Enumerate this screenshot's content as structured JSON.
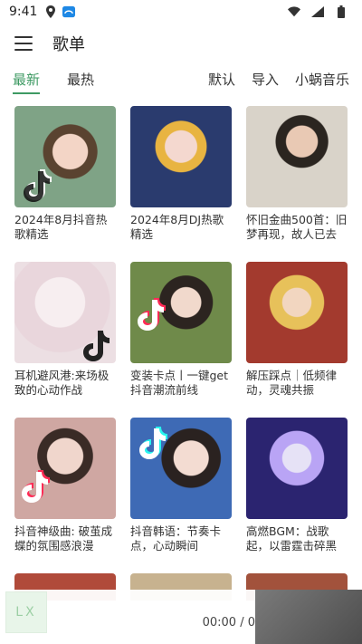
{
  "status_bar": {
    "time": "9:41"
  },
  "app_bar": {
    "title": "歌单"
  },
  "tabs": {
    "left": [
      {
        "label": "最新",
        "active": true
      },
      {
        "label": "最热",
        "active": false
      }
    ],
    "right": [
      {
        "label": "默认"
      },
      {
        "label": "导入"
      },
      {
        "label": "小蜗音乐"
      }
    ]
  },
  "playlists": [
    {
      "name": "2024年8月抖音热歌精选",
      "cover_color": "#7fa386"
    },
    {
      "name": "2024年8月DJ热歌精选",
      "cover_color": "#2a3b6e"
    },
    {
      "name": "怀旧金曲500首：旧梦再现，故人已去",
      "cover_color": "#d9d3c9"
    },
    {
      "name": "耳机避风港:来场极致的心动作战",
      "cover_color": "#ecdfe3"
    },
    {
      "name": "变装卡点丨一键get抖音潮流前线",
      "cover_color": "#6f8a4a"
    },
    {
      "name": "解压踩点｜低频律动，灵魂共振",
      "cover_color": "#a33a2e"
    },
    {
      "name": "抖音神级曲: 破茧成蝶的氛围感浪漫",
      "cover_color": "#cfa7a2"
    },
    {
      "name": "抖音韩语：节奏卡点，心动瞬间",
      "cover_color": "#3e6ab5"
    },
    {
      "name": "高燃BGM：战歌起，以雷霆击碎黑暗!",
      "cover_color": "#2b2470"
    }
  ],
  "partial_covers": [
    "#b04a3a",
    "#c7b28f",
    "#a2523c"
  ],
  "player": {
    "thumb_text": "LX",
    "time": "00:00 / 0"
  },
  "colors": {
    "accent": "#3e9a63"
  }
}
